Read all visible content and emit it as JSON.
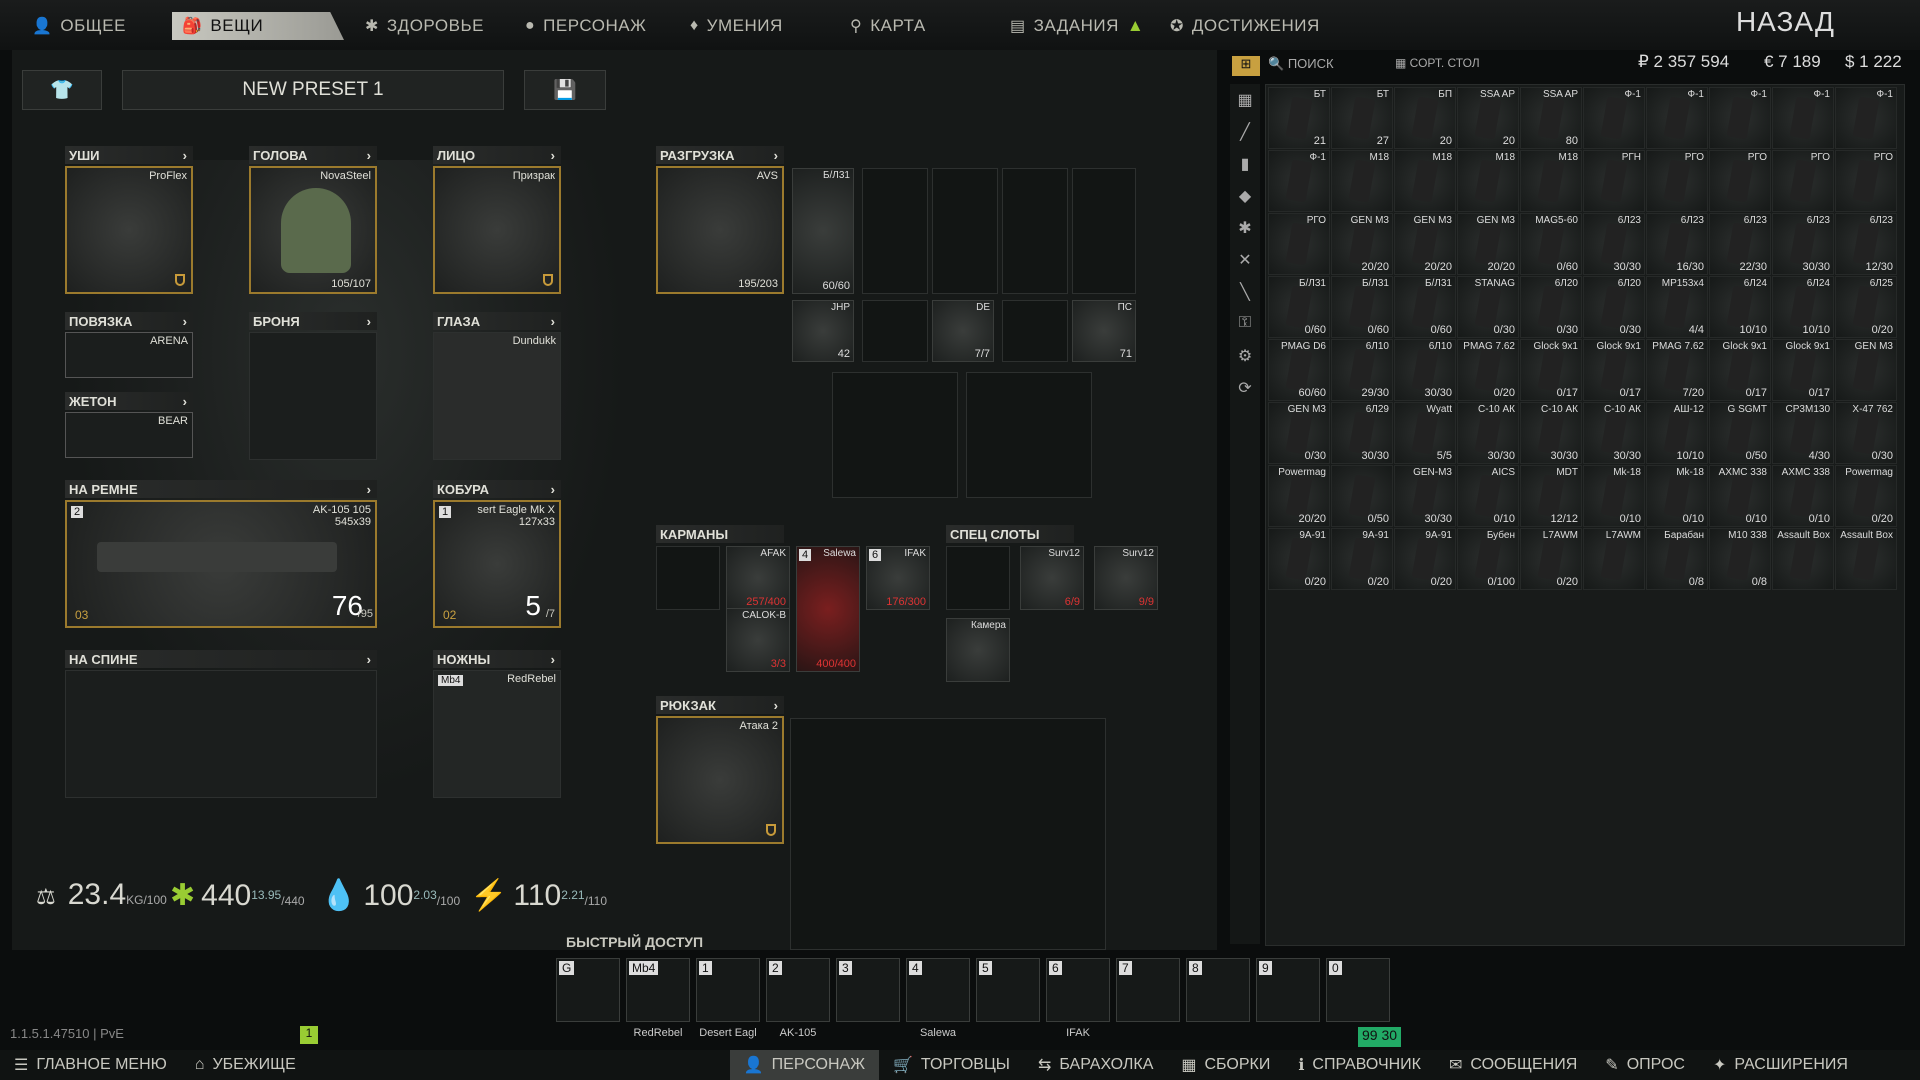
{
  "tabs": [
    {
      "label": "ОБЩЕЕ",
      "icon": "person-icon"
    },
    {
      "label": "ВЕЩИ",
      "icon": "gear-icon"
    },
    {
      "label": "ЗДОРОВЬЕ",
      "icon": "health-icon"
    },
    {
      "label": "ПЕРСОНАЖ",
      "icon": "face-icon"
    },
    {
      "label": "УМЕНИЯ",
      "icon": "skills-icon"
    },
    {
      "label": "КАРТА",
      "icon": "map-pin-icon"
    },
    {
      "label": "ЗАДАНИЯ",
      "icon": "tasks-icon"
    },
    {
      "label": "ДОСТИЖЕНИЯ",
      "icon": "achievements-icon"
    }
  ],
  "back_label": "НАЗАД",
  "preset": {
    "name": "NEW PRESET 1"
  },
  "slots": {
    "ears": {
      "label": "УШИ",
      "item": "ProFlex"
    },
    "head": {
      "label": "ГОЛОВА",
      "item": "NovaSteel",
      "durability": "105/107"
    },
    "face": {
      "label": "ЛИЦО",
      "item": "Призрак"
    },
    "armband": {
      "label": "ПОВЯЗКА",
      "item": "ARENA"
    },
    "armor": {
      "label": "БРОНЯ"
    },
    "eyes": {
      "label": "ГЛАЗА",
      "item": "Dundukk"
    },
    "dogtag": {
      "label": "ЖЕТОН",
      "item": "BEAR"
    },
    "rig": {
      "label": "РАЗГРУЗКА",
      "item": "AVS",
      "durability": "195/203"
    },
    "primary": {
      "label": "НА РЕМНЕ",
      "item": "AK-105 105",
      "size": "545x39",
      "ammo": "76",
      "ammo_max": "/95",
      "key": "2",
      "count": "03"
    },
    "holster": {
      "label": "КОБУРА",
      "item": "sert Eagle Mk X",
      "size": "127x33",
      "ammo": "5",
      "ammo_max": "/7",
      "key": "1",
      "count": "02"
    },
    "back": {
      "label": "НА СПИНЕ"
    },
    "melee": {
      "label": "НОЖНЫ",
      "item": "RedRebel",
      "key": "Mb4"
    },
    "pockets": {
      "label": "КАРМАНЫ"
    },
    "special": {
      "label": "СПЕЦ СЛОТЫ"
    },
    "backpack": {
      "label": "РЮКЗАК",
      "item": "Атака 2"
    }
  },
  "rig_items": [
    {
      "nm": "Б/Л31",
      "ct": "60/60"
    },
    {
      "nm": "JHP",
      "ct": "42"
    },
    {
      "nm": "DE",
      "ct": "7/7"
    },
    {
      "nm": "ПС",
      "ct": "71"
    }
  ],
  "pocket_items": [
    {
      "nm": "AFAK",
      "ct": "257/400"
    },
    {
      "nm": "Salewa",
      "ct": "400/400",
      "key": "4"
    },
    {
      "nm": "IFAK",
      "ct": "176/300",
      "key": "6"
    },
    {
      "nm": "CALOK-B",
      "ct": "3/3"
    }
  ],
  "special_items": [
    {
      "nm": "Surv12",
      "ct": "6/9"
    },
    {
      "nm": "Surv12",
      "ct": "9/9"
    },
    {
      "nm": "Камера",
      "ct": ""
    }
  ],
  "stats": {
    "weight": "23.4",
    "weight_unit": "KG",
    "weight_max": "/100",
    "energy": "440",
    "energy_max": "/440",
    "energy_rate": "13.95",
    "water": "100",
    "water_max": "/100",
    "water_rate": "2.03",
    "power": "110",
    "power_max": "/110",
    "power_rate": "2.21"
  },
  "quick_access": {
    "title": "БЫСТРЫЙ ДОСТУП",
    "slots": [
      {
        "k": "G",
        "lbl": ""
      },
      {
        "k": "Mb4",
        "lbl": "RedRebel"
      },
      {
        "k": "1",
        "lbl": "Desert Eagl"
      },
      {
        "k": "2",
        "lbl": "AK-105"
      },
      {
        "k": "3",
        "lbl": ""
      },
      {
        "k": "4",
        "lbl": "Salewa"
      },
      {
        "k": "5",
        "lbl": ""
      },
      {
        "k": "6",
        "lbl": "IFAK"
      },
      {
        "k": "7",
        "lbl": ""
      },
      {
        "k": "8",
        "lbl": ""
      },
      {
        "k": "9",
        "lbl": ""
      },
      {
        "k": "0",
        "lbl": ""
      }
    ]
  },
  "stash": {
    "search_label": "ПОИСК",
    "sort_label": "СОРТ. СТОЛ",
    "rub": "₽ 2 357 594",
    "eur": "€ 7 189",
    "usd": "$ 1 222",
    "items": [
      {
        "nm": "БТ",
        "ct": "21"
      },
      {
        "nm": "БТ",
        "ct": "27"
      },
      {
        "nm": "БП",
        "ct": "20"
      },
      {
        "nm": "SSA AP",
        "ct": "20"
      },
      {
        "nm": "SSA AP",
        "ct": "80"
      },
      {
        "nm": "Ф-1",
        "ct": ""
      },
      {
        "nm": "Ф-1",
        "ct": ""
      },
      {
        "nm": "Ф-1",
        "ct": ""
      },
      {
        "nm": "Ф-1",
        "ct": ""
      },
      {
        "nm": "Ф-1",
        "ct": ""
      },
      {
        "nm": "Ф-1",
        "ct": ""
      },
      {
        "nm": "M18",
        "ct": ""
      },
      {
        "nm": "M18",
        "ct": ""
      },
      {
        "nm": "M18",
        "ct": ""
      },
      {
        "nm": "M18",
        "ct": ""
      },
      {
        "nm": "РГН",
        "ct": ""
      },
      {
        "nm": "РГО",
        "ct": ""
      },
      {
        "nm": "РГО",
        "ct": ""
      },
      {
        "nm": "РГО",
        "ct": ""
      },
      {
        "nm": "РГО",
        "ct": ""
      },
      {
        "nm": "РГО",
        "ct": ""
      },
      {
        "nm": "GEN M3",
        "ct": "20/20"
      },
      {
        "nm": "GEN M3",
        "ct": "20/20"
      },
      {
        "nm": "GEN M3",
        "ct": "20/20"
      },
      {
        "nm": "MAG5-60",
        "ct": "0/60"
      },
      {
        "nm": "6Л23",
        "ct": "30/30"
      },
      {
        "nm": "6Л23",
        "ct": "16/30"
      },
      {
        "nm": "6Л23",
        "ct": "22/30"
      },
      {
        "nm": "6Л23",
        "ct": "30/30"
      },
      {
        "nm": "6Л23",
        "ct": "12/30"
      },
      {
        "nm": "Б/Л31",
        "ct": "0/60"
      },
      {
        "nm": "Б/Л31",
        "ct": "0/60"
      },
      {
        "nm": "Б/Л31",
        "ct": "0/60"
      },
      {
        "nm": "STANAG",
        "ct": "0/30"
      },
      {
        "nm": "6Л20",
        "ct": "0/30"
      },
      {
        "nm": "6Л20",
        "ct": "0/30"
      },
      {
        "nm": "MP153x4",
        "ct": "4/4"
      },
      {
        "nm": "6Л24",
        "ct": "10/10"
      },
      {
        "nm": "6Л24",
        "ct": "10/10"
      },
      {
        "nm": "6Л25",
        "ct": "0/20"
      },
      {
        "nm": "PMAG D6",
        "ct": "60/60"
      },
      {
        "nm": "6Л10",
        "ct": "29/30"
      },
      {
        "nm": "6Л10",
        "ct": "30/30"
      },
      {
        "nm": "PMAG 7.62",
        "ct": "0/20"
      },
      {
        "nm": "Glock 9x1",
        "ct": "0/17"
      },
      {
        "nm": "Glock 9x1",
        "ct": "0/17"
      },
      {
        "nm": "PMAG 7.62",
        "ct": "7/20"
      },
      {
        "nm": "Glock 9x1",
        "ct": "0/17"
      },
      {
        "nm": "Glock 9x1",
        "ct": "0/17"
      },
      {
        "nm": "GEN M3",
        "ct": ""
      },
      {
        "nm": "GEN M3",
        "ct": "0/30"
      },
      {
        "nm": "6Л29",
        "ct": "30/30"
      },
      {
        "nm": "Wyatt",
        "ct": "5/5"
      },
      {
        "nm": "С-10 АК",
        "ct": "30/30"
      },
      {
        "nm": "С-10 АК",
        "ct": "30/30"
      },
      {
        "nm": "С-10 АК",
        "ct": "30/30"
      },
      {
        "nm": "АШ-12",
        "ct": "10/10"
      },
      {
        "nm": "G SGMT",
        "ct": "0/50"
      },
      {
        "nm": "CP3M130",
        "ct": "4/30"
      },
      {
        "nm": "X-47 762",
        "ct": "0/30"
      },
      {
        "nm": "Powermag",
        "ct": "20/20"
      },
      {
        "nm": "",
        "ct": "0/50"
      },
      {
        "nm": "GEN-M3",
        "ct": "30/30"
      },
      {
        "nm": "AICS",
        "ct": "0/10"
      },
      {
        "nm": "MDT",
        "ct": "12/12"
      },
      {
        "nm": "Mk-18",
        "ct": "0/10"
      },
      {
        "nm": "Mk-18",
        "ct": "0/10"
      },
      {
        "nm": "AXMC 338",
        "ct": "0/10"
      },
      {
        "nm": "AXMC 338",
        "ct": "0/10"
      },
      {
        "nm": "Powermag",
        "ct": "0/20"
      },
      {
        "nm": "9A-91",
        "ct": "0/20"
      },
      {
        "nm": "9A-91",
        "ct": "0/20"
      },
      {
        "nm": "9A-91",
        "ct": "0/20"
      },
      {
        "nm": "Бубен",
        "ct": "0/100"
      },
      {
        "nm": "L7AWM",
        "ct": "0/20"
      },
      {
        "nm": "L7AWM",
        "ct": ""
      },
      {
        "nm": "Барабан",
        "ct": "0/8"
      },
      {
        "nm": "M10 338",
        "ct": "0/8"
      },
      {
        "nm": "Assault Box",
        "ct": ""
      },
      {
        "nm": "Assault Box",
        "ct": ""
      }
    ]
  },
  "version": "1.1.5.1.47510 | PvE",
  "bottom": [
    {
      "label": "ГЛАВНОЕ МЕНЮ",
      "icon": "menu-icon"
    },
    {
      "label": "УБЕЖИЩЕ",
      "icon": "hideout-icon"
    },
    {
      "label": "ПЕРСОНАЖ",
      "icon": "character-icon"
    },
    {
      "label": "ТОРГОВЦЫ",
      "icon": "cart-icon"
    },
    {
      "label": "БАРАХОЛКА",
      "icon": "flea-icon"
    },
    {
      "label": "СБОРКИ",
      "icon": "builds-icon"
    },
    {
      "label": "СПРАВОЧНИК",
      "icon": "handbook-icon"
    },
    {
      "label": "СООБЩЕНИЯ",
      "icon": "messages-icon"
    },
    {
      "label": "ОПРОС",
      "icon": "survey-icon"
    },
    {
      "label": "РАСШИРЕНИЯ",
      "icon": "extensions-icon"
    }
  ],
  "level_badge": "1",
  "indicators": {
    "a": "99",
    "b": "30"
  }
}
